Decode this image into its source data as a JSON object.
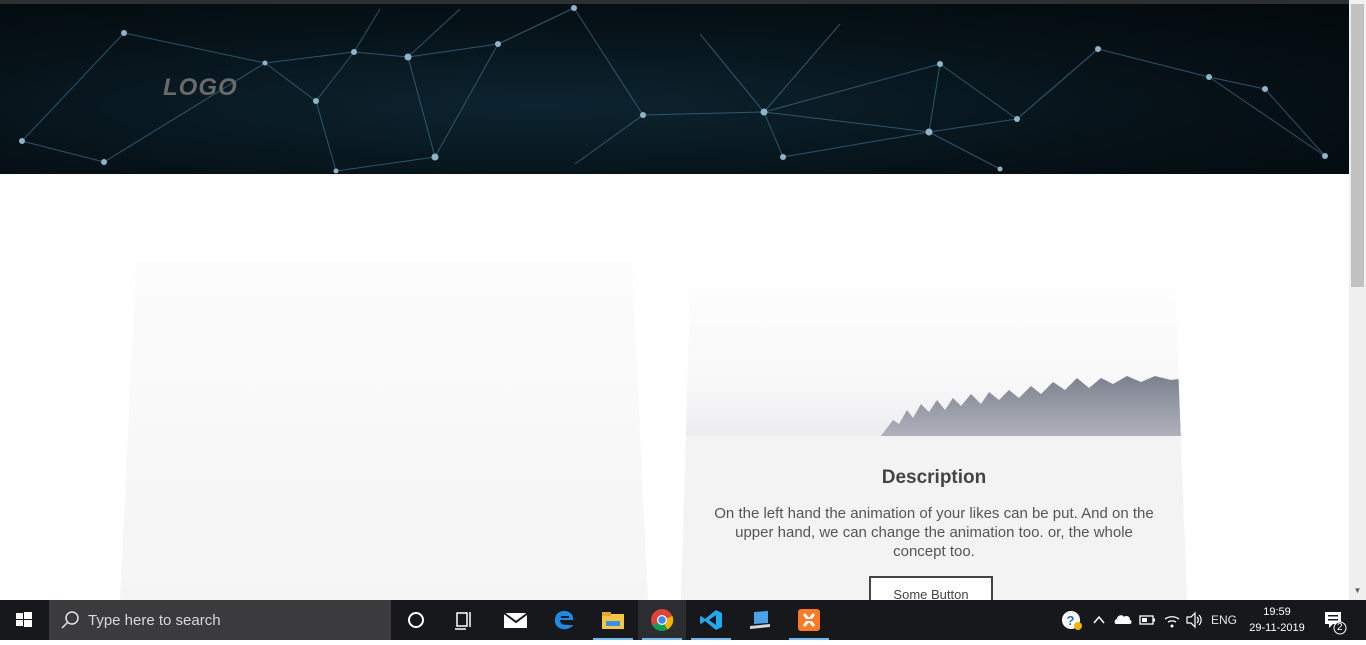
{
  "header": {
    "logo": "LOGO"
  },
  "card": {
    "title": "Description",
    "description": "On the left hand the animation of your likes can be put. And on the upper hand, we can change the animation too. or, the whole concept too.",
    "button_label": "Some Button"
  },
  "taskbar": {
    "search_placeholder": "Type here to search",
    "apps": [
      "cortana-icon",
      "task-view-icon",
      "mail-icon",
      "edge-icon",
      "file-explorer-icon",
      "chrome-icon",
      "vscode-icon",
      "laptop-app-icon",
      "xampp-icon"
    ],
    "tray": {
      "language": "ENG",
      "time": "19:59",
      "date": "29-11-2019",
      "notification_count": "2"
    }
  },
  "colors": {
    "hero_background": "#061218",
    "network_lines": "#3a6a86",
    "taskbar": "#17181b",
    "active_underline": "#76b9ed"
  }
}
